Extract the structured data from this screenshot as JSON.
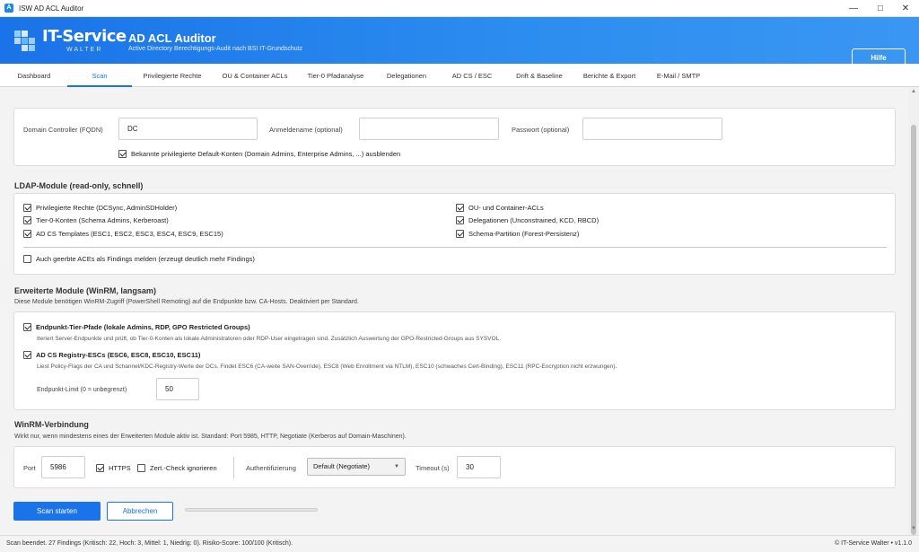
{
  "window": {
    "title": "ISW AD ACL Auditor"
  },
  "header": {
    "logo_text": "IT-Service",
    "logo_sub": "WALTER",
    "title": "AD ACL Auditor",
    "subtitle": "Active Directory Berechtigungs-Audit nach BSI IT-Grundschutz",
    "help_label": "Hilfe"
  },
  "tabs": [
    {
      "label": "Dashboard"
    },
    {
      "label": "Scan"
    },
    {
      "label": "Privilegierte Rechte"
    },
    {
      "label": "OU & Container ACLs"
    },
    {
      "label": "Tier-0 Pfadanalyse"
    },
    {
      "label": "Delegationen"
    },
    {
      "label": "AD CS / ESC"
    },
    {
      "label": "Drift & Baseline"
    },
    {
      "label": "Berichte & Export"
    },
    {
      "label": "E-Mail / SMTP"
    }
  ],
  "active_tab": "Scan",
  "connection": {
    "dc_label": "Domain Controller (FQDN)",
    "dc_value": "DC",
    "user_label": "Anmeldename (optional)",
    "user_value": "",
    "pw_label": "Passwort (optional)",
    "pw_value": "",
    "hide_defaults_label": "Bekannte privilegierte Default-Konten (Domain Admins, Enterprise Admins, ...) ausblenden",
    "hide_defaults_checked": true
  },
  "ldap": {
    "title": "LDAP-Module (read-only, schnell)",
    "left": [
      {
        "label": "Privilegierte Rechte (DCSync, AdminSDHolder)",
        "checked": true
      },
      {
        "label": "Tier-0-Konten (Schema Admins, Kerberoast)",
        "checked": true
      },
      {
        "label": "AD CS Templates (ESC1, ESC2, ESC3, ESC4, ESC9, ESC15)",
        "checked": true
      }
    ],
    "right": [
      {
        "label": "OU- und Container-ACLs",
        "checked": true
      },
      {
        "label": "Delegationen (Unconstrained, KCD, RBCD)",
        "checked": true
      },
      {
        "label": "Schema-Partition (Forest-Persistenz)",
        "checked": true
      }
    ],
    "inherited_label": "Auch geerbte ACEs als Findings melden (erzeugt deutlich mehr Findings)",
    "inherited_checked": false
  },
  "extended": {
    "title": "Erweiterte Module (WinRM, langsam)",
    "desc": "Diese Module benötigen WinRM-Zugriff (PowerShell Remoting) auf die Endpunkte bzw. CA-Hosts. Deaktiviert per Standard.",
    "mod1_label": "Endpunkt-Tier-Pfade (lokale Admins, RDP, GPO Restricted Groups)",
    "mod1_checked": true,
    "mod1_desc": "Iteriert Server-Endpunkte und prüft, ob Tier-0-Konten als lokale Administratoren oder RDP-User eingetragen sind. Zusätzlich Auswertung der GPO-Restricted-Groups aus SYSVOL.",
    "mod2_label": "AD CS Registry-ESCs (ESC6, ESC8, ESC10, ESC11)",
    "mod2_checked": true,
    "mod2_desc": "Liest Policy-Flags der CA und Schannel/KDC-Registry-Werte der DCs. Findet ESC6 (CA-weite SAN-Override), ESC8 (Web Enrollment via NTLM), ESC10 (schwaches Cert-Binding), ESC11 (RPC-Encryption nicht erzwungen).",
    "limit_label": "Endpunkt-Limit (0 = unbegrenzt)",
    "limit_value": "50"
  },
  "winrm": {
    "title": "WinRM-Verbindung",
    "desc": "Wirkt nur, wenn mindestens eines der Erweiterten Module aktiv ist. Standard: Port 5985, HTTP, Negotiate (Kerberos auf Domain-Maschinen).",
    "port_label": "Port",
    "port_value": "5986",
    "https_label": "HTTPS",
    "https_checked": true,
    "certcheck_label": "Zert.-Check ignorieren",
    "certcheck_checked": false,
    "auth_label": "Authentifizierung",
    "auth_value": "Default (Negotiate)",
    "timeout_label": "Timeout (s)",
    "timeout_value": "30"
  },
  "actions": {
    "start_label": "Scan starten",
    "cancel_label": "Abbrechen",
    "progress_fraction": 0
  },
  "status": {
    "left": "Scan beendet. 27 Findings (Kritisch: 22, Hoch: 3, Mittel: 1, Niedrig: 0). Risiko-Score: 100/100 (Kritisch).",
    "right": "© IT-Service Walter  •  v1.1.0"
  },
  "colors": {
    "accent": "#1a73e8",
    "header_bg": "#2d8ef0"
  },
  "icons": {
    "app": "shield-icon",
    "minimize": "minimize-icon",
    "maximize": "maximize-icon",
    "close": "close-icon"
  }
}
